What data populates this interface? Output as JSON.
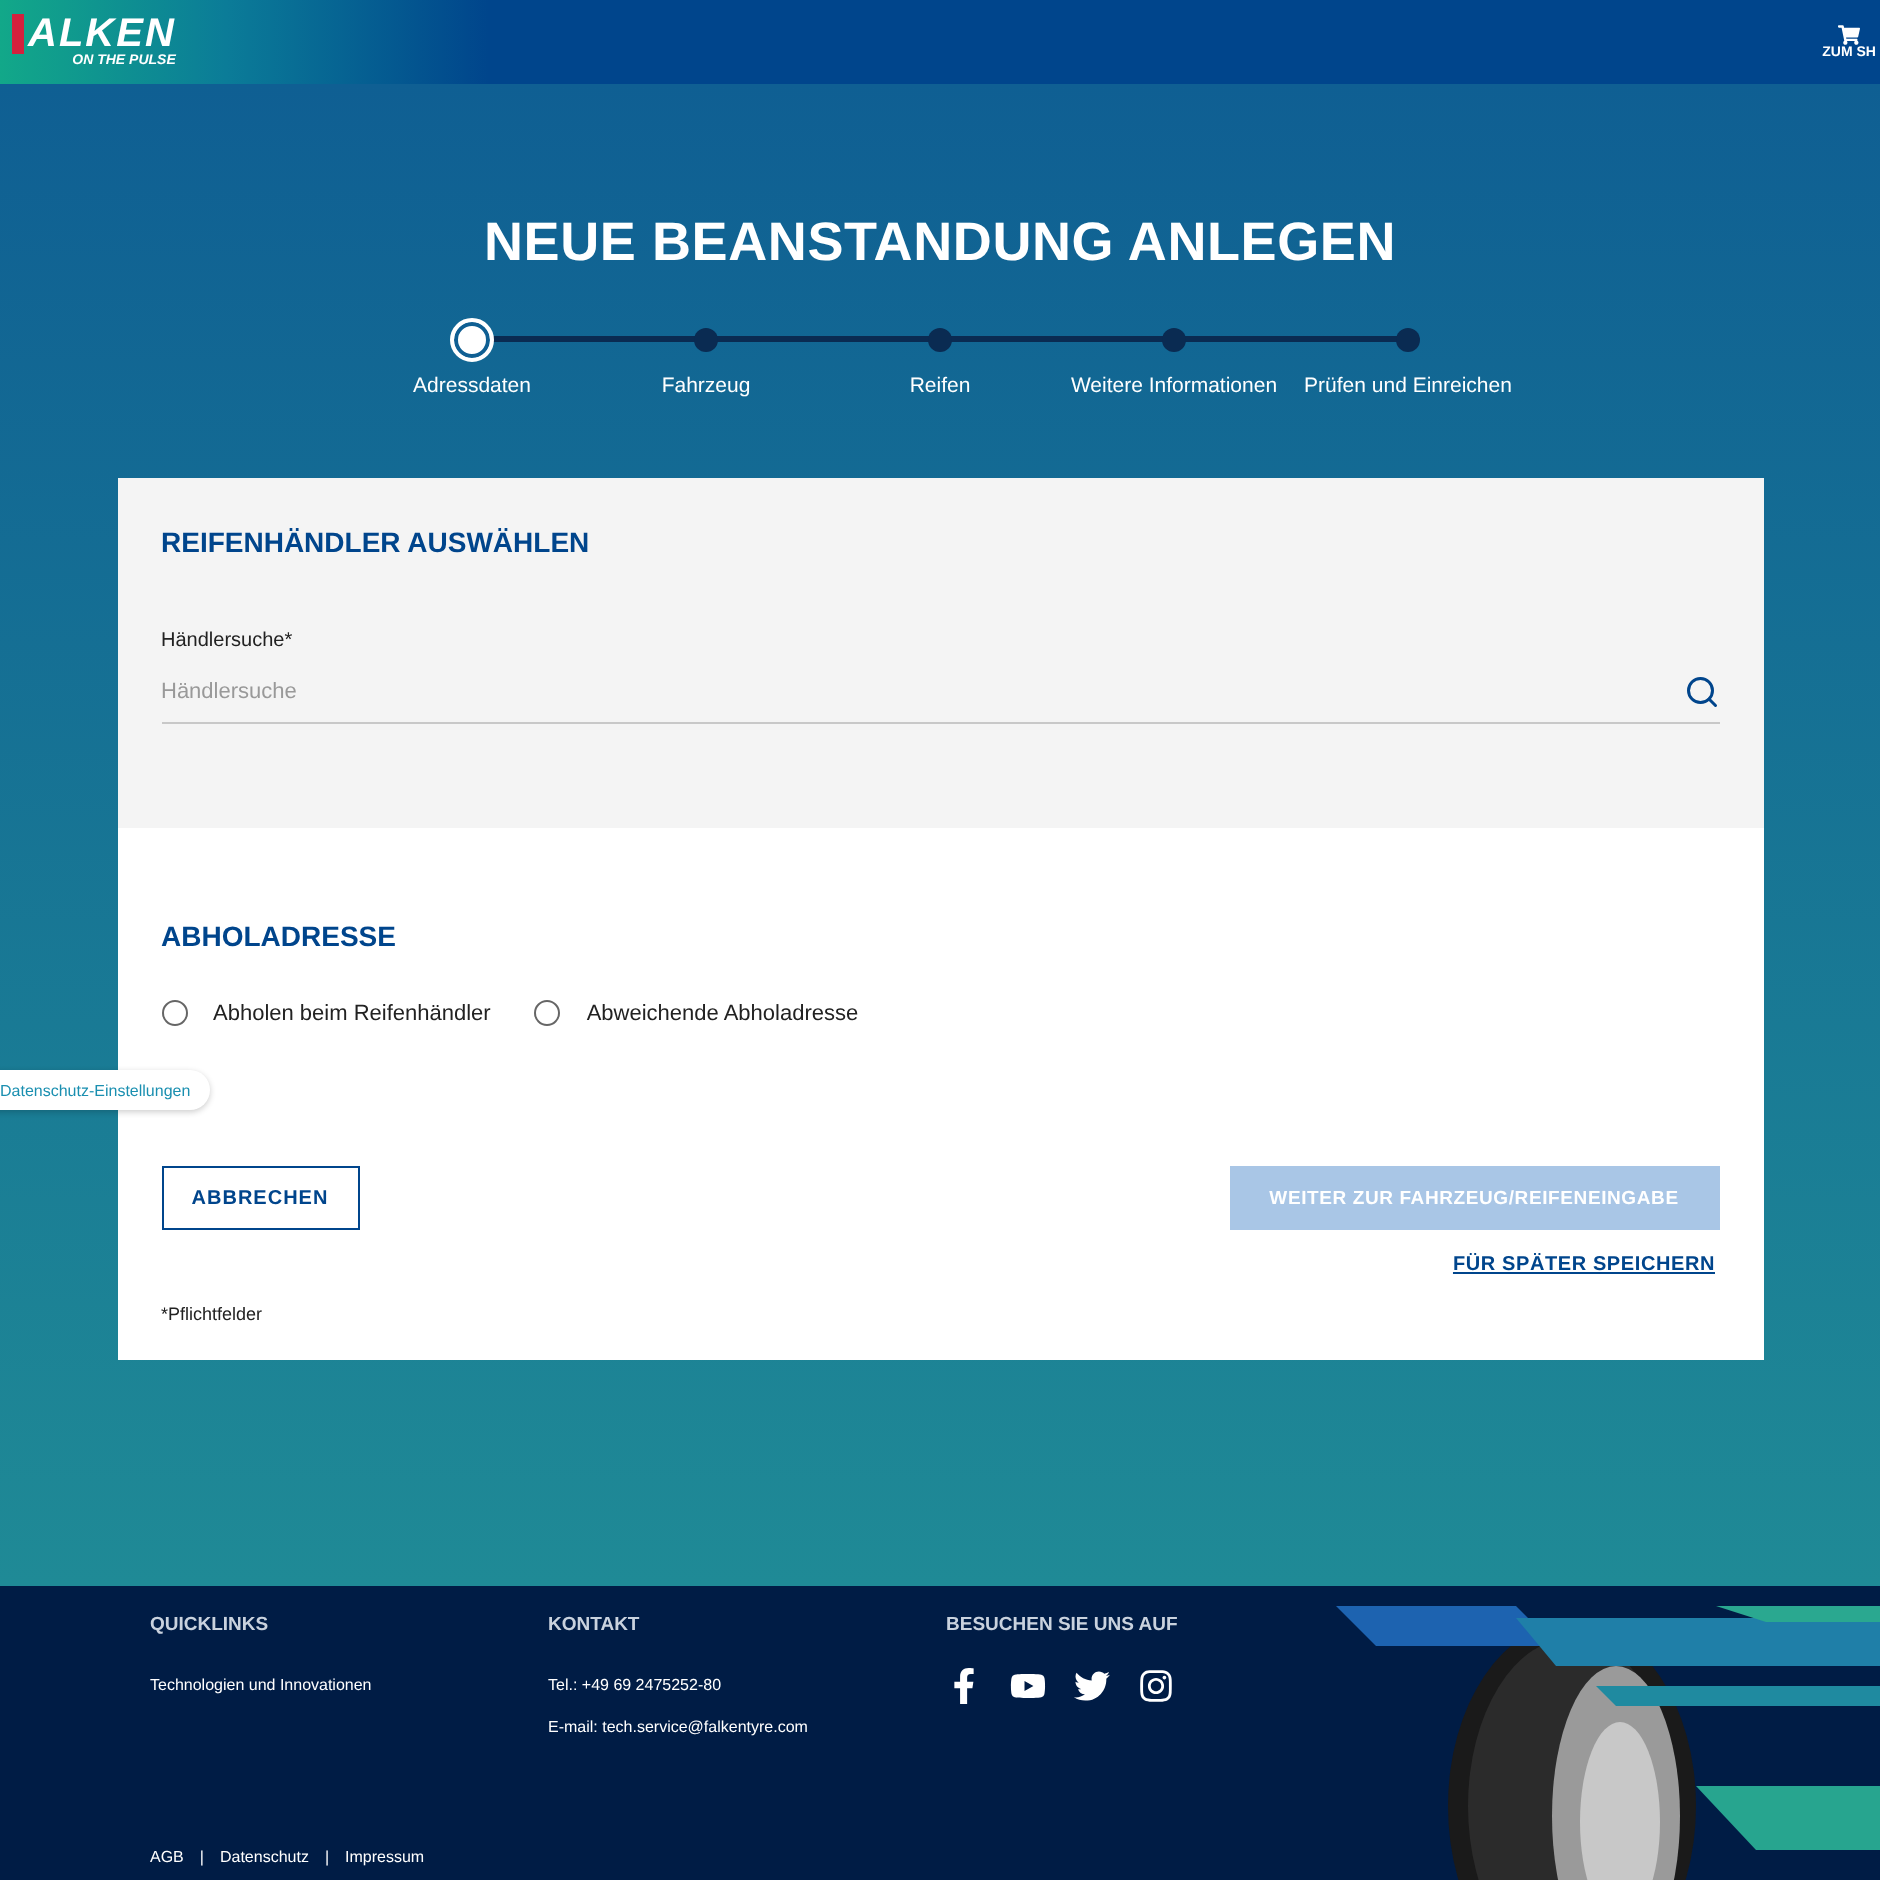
{
  "header": {
    "logo": "ALKEN",
    "tagline": "ON THE PULSE",
    "shop_link": "ZUM SH"
  },
  "title": "NEUE BEANSTANDUNG ANLEGEN",
  "steps": [
    {
      "label": "Adressdaten",
      "selected": true
    },
    {
      "label": "Fahrzeug",
      "selected": false
    },
    {
      "label": "Reifen",
      "selected": false
    },
    {
      "label": "Weitere Informationen",
      "selected": false
    },
    {
      "label": "Prüfen und Einreichen",
      "selected": false
    }
  ],
  "dealer_section": {
    "heading": "REIFENHÄNDLER AUSWÄHLEN",
    "field_label": "Händlersuche*",
    "placeholder": "Händlersuche"
  },
  "pickup_section": {
    "heading": "ABHOLADRESSE",
    "options": [
      {
        "label": "Abholen beim Reifenhändler",
        "selected": false
      },
      {
        "label": "Abweichende Abholadresse",
        "selected": false
      }
    ]
  },
  "privacy_button": "Datenschutz-Einstellungen",
  "actions": {
    "cancel": "ABBRECHEN",
    "next": {
      "label": "WEITER ZUR FAHRZEUG/REIFENEINGABE",
      "disabled": true
    },
    "save": "FÜR SPÄTER SPEICHERN"
  },
  "required_note": "*Pflichtfelder",
  "footer": {
    "columns": [
      {
        "kind": "links",
        "heading": "QUICKLINKS",
        "items": [
          "Technologien und Innovationen"
        ]
      },
      {
        "kind": "contact",
        "heading": "KONTAKT",
        "items": [
          "Tel.: +49 69 2475252-80",
          "E-mail: tech.service@falkentyre.com"
        ]
      },
      {
        "kind": "social",
        "heading": "BESUCHEN SIE UNS AUF"
      }
    ],
    "legal_links": [
      "AGB",
      "Datenschutz",
      "Impressum"
    ],
    "separator": "|"
  }
}
